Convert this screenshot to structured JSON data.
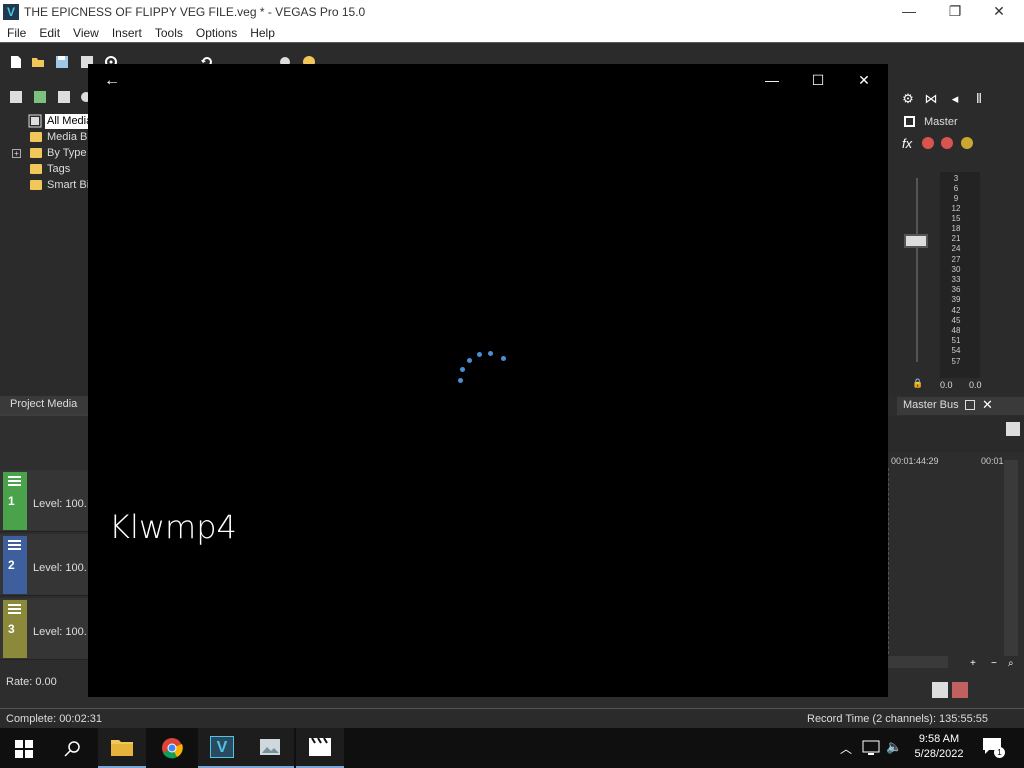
{
  "window": {
    "title": "THE EPICNESS OF FLIPPY VEG FILE.veg * - VEGAS Pro 15.0",
    "app_icon_letter": "V",
    "controls": {
      "minimize": "—",
      "maximize": "❐",
      "close": "✕"
    }
  },
  "menu": [
    "File",
    "Edit",
    "View",
    "Insert",
    "Tools",
    "Options",
    "Help"
  ],
  "explorer": {
    "items": [
      "All Media",
      "Media Bi",
      "By Type",
      "Tags",
      "Smart Bi"
    ],
    "selected": "All Media"
  },
  "tabs_left": {
    "project_media": "Project Media"
  },
  "tracks": [
    {
      "number": "1",
      "level": "Level: 100.",
      "color": "#4aa34a"
    },
    {
      "number": "2",
      "level": "Level: 100.",
      "color": "#3d5f9e"
    },
    {
      "number": "3",
      "level": "Level: 100.",
      "color": "#8a8a3a"
    }
  ],
  "rate": "Rate: 0.00",
  "mixer": {
    "master_label": "Master",
    "meter_ticks": [
      "3",
      "6",
      "9",
      "12",
      "15",
      "18",
      "21",
      "24",
      "27",
      "30",
      "33",
      "36",
      "39",
      "42",
      "45",
      "48",
      "51",
      "54",
      "57"
    ],
    "vol_left": "0.0",
    "vol_right": "0.0",
    "master_bus": "Master Bus"
  },
  "timeline": {
    "timecode_1": "00:01:44:29",
    "timecode_2": "00:01"
  },
  "status": {
    "left": "Complete: 00:02:31",
    "right": "Record Time (2 channels): 135:55:55"
  },
  "viewer": {
    "filename": "Klwmp4",
    "back": "←",
    "minimize": "—",
    "maximize": "☐",
    "close": "✕"
  },
  "taskbar": {
    "time": "9:58 AM",
    "date": "5/28/2022",
    "notification_count": "1"
  },
  "colors": {
    "accent": "#4a8fd4",
    "taskbar_active": "#7aa7d6"
  }
}
